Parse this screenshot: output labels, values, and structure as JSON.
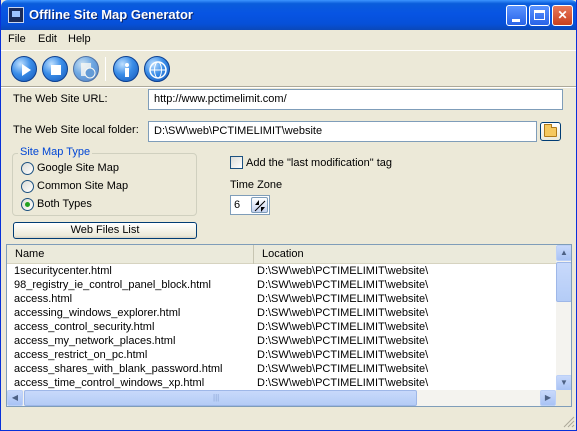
{
  "window": {
    "title": "Offline Site Map Generator",
    "controls": {
      "minimize": "",
      "maximize": "",
      "close": "✕"
    }
  },
  "menu": [
    "File",
    "Edit",
    "Help"
  ],
  "toolbar": {
    "buttons": [
      "play-icon",
      "stop-icon",
      "page-globe-icon",
      "info-icon",
      "globe-icon"
    ]
  },
  "form": {
    "url_label": "The Web Site URL:",
    "url_value": "http://www.pctimelimit.com/",
    "folder_label": "The Web Site local folder:",
    "folder_value": "D:\\SW\\web\\PCTIMELIMIT\\website",
    "sitemap_type": {
      "title": "Site Map Type",
      "options": [
        "Google Site Map",
        "Common Site Map",
        "Both Types"
      ],
      "selected": "Both Types"
    },
    "last_mod_label": "Add the \"last modification\" tag",
    "last_mod_checked": false,
    "timezone_label": "Time Zone",
    "timezone_value": "6",
    "web_files_button": "Web Files List"
  },
  "files": {
    "columns": [
      "Name",
      "Location"
    ],
    "rows": [
      {
        "name": "1securitycenter.html",
        "location": "D:\\SW\\web\\PCTIMELIMIT\\website\\"
      },
      {
        "name": "98_registry_ie_control_panel_block.html",
        "location": "D:\\SW\\web\\PCTIMELIMIT\\website\\"
      },
      {
        "name": "access.html",
        "location": "D:\\SW\\web\\PCTIMELIMIT\\website\\"
      },
      {
        "name": "accessing_windows_explorer.html",
        "location": "D:\\SW\\web\\PCTIMELIMIT\\website\\"
      },
      {
        "name": "access_control_security.html",
        "location": "D:\\SW\\web\\PCTIMELIMIT\\website\\"
      },
      {
        "name": "access_my_network_places.html",
        "location": "D:\\SW\\web\\PCTIMELIMIT\\website\\"
      },
      {
        "name": "access_restrict_on_pc.html",
        "location": "D:\\SW\\web\\PCTIMELIMIT\\website\\"
      },
      {
        "name": "access_shares_with_blank_password.html",
        "location": "D:\\SW\\web\\PCTIMELIMIT\\website\\"
      },
      {
        "name": "access_time_control_windows_xp.html",
        "location": "D:\\SW\\web\\PCTIMELIMIT\\website\\"
      }
    ]
  },
  "scroll": {
    "up": "▲",
    "down": "▼",
    "left": "◀",
    "right": "▶",
    "grip": "|||"
  }
}
